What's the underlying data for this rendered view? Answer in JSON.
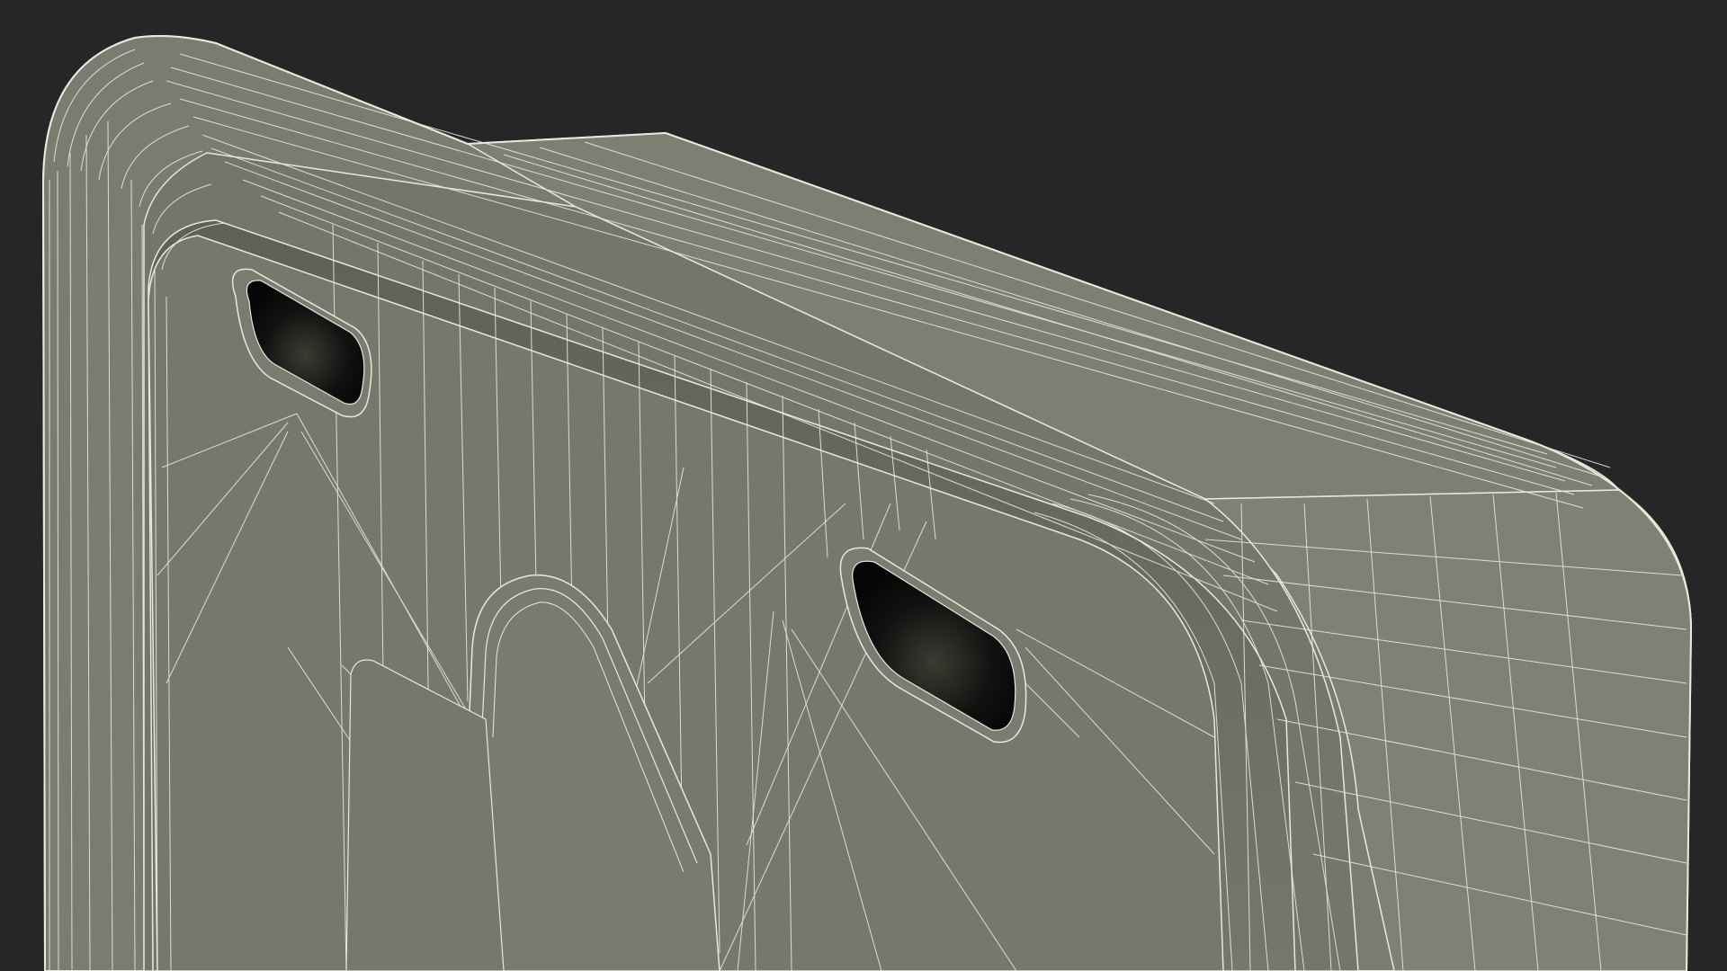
{
  "scene": {
    "subject": "wireframe-3d-render",
    "colors": {
      "background": "#262626",
      "surface": "#7b7c70",
      "surface_light": "#86887b",
      "surface_dark": "#6c6d62",
      "wire": "#e8e8dc",
      "slot": "#0c0d0b"
    }
  }
}
